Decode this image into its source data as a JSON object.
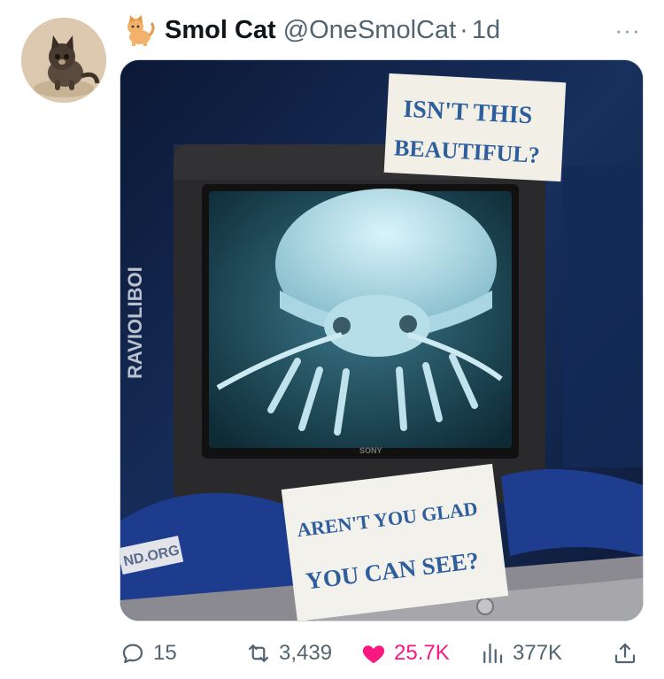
{
  "post": {
    "display_name": "Smol Cat",
    "handle": "@OneSmolCat",
    "separator": "·",
    "time": "1d",
    "more_label": "···"
  },
  "image": {
    "sign_top_line1": "ISN'T THIS",
    "sign_top_line2": "BEAUTIFUL?",
    "sign_bottom_line1": "AREN'T YOU GLAD",
    "sign_bottom_line2": "YOU CAN SEE?",
    "side_watermark": "RAVIOLIBOI",
    "corner_text": "ND.ORG",
    "tv_brand": "SONY"
  },
  "actions": {
    "replies": "15",
    "reposts": "3,439",
    "likes": "25.7K",
    "views": "377K"
  },
  "colors": {
    "like": "#f91880",
    "muted": "#536471",
    "text": "#0f1419"
  }
}
